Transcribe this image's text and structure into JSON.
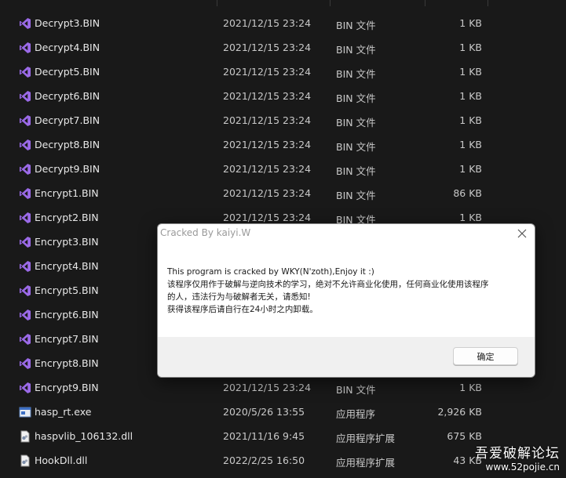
{
  "files": [
    {
      "name": "Decrypt3.BIN",
      "date": "2021/12/15 23:24",
      "type": "BIN 文件",
      "size": "1 KB",
      "icon": "vs-icon"
    },
    {
      "name": "Decrypt4.BIN",
      "date": "2021/12/15 23:24",
      "type": "BIN 文件",
      "size": "1 KB",
      "icon": "vs-icon"
    },
    {
      "name": "Decrypt5.BIN",
      "date": "2021/12/15 23:24",
      "type": "BIN 文件",
      "size": "1 KB",
      "icon": "vs-icon"
    },
    {
      "name": "Decrypt6.BIN",
      "date": "2021/12/15 23:24",
      "type": "BIN 文件",
      "size": "1 KB",
      "icon": "vs-icon"
    },
    {
      "name": "Decrypt7.BIN",
      "date": "2021/12/15 23:24",
      "type": "BIN 文件",
      "size": "1 KB",
      "icon": "vs-icon"
    },
    {
      "name": "Decrypt8.BIN",
      "date": "2021/12/15 23:24",
      "type": "BIN 文件",
      "size": "1 KB",
      "icon": "vs-icon"
    },
    {
      "name": "Decrypt9.BIN",
      "date": "2021/12/15 23:24",
      "type": "BIN 文件",
      "size": "1 KB",
      "icon": "vs-icon"
    },
    {
      "name": "Encrypt1.BIN",
      "date": "2021/12/15 23:24",
      "type": "BIN 文件",
      "size": "86 KB",
      "icon": "vs-icon"
    },
    {
      "name": "Encrypt2.BIN",
      "date": "2021/12/15 23:24",
      "type": "BIN 文件",
      "size": "1 KB",
      "icon": "vs-icon"
    },
    {
      "name": "Encrypt3.BIN",
      "date": "",
      "type": "",
      "size": "",
      "icon": "vs-icon"
    },
    {
      "name": "Encrypt4.BIN",
      "date": "",
      "type": "",
      "size": "",
      "icon": "vs-icon"
    },
    {
      "name": "Encrypt5.BIN",
      "date": "",
      "type": "",
      "size": "",
      "icon": "vs-icon"
    },
    {
      "name": "Encrypt6.BIN",
      "date": "",
      "type": "",
      "size": "",
      "icon": "vs-icon"
    },
    {
      "name": "Encrypt7.BIN",
      "date": "",
      "type": "",
      "size": "",
      "icon": "vs-icon"
    },
    {
      "name": "Encrypt8.BIN",
      "date": "",
      "type": "",
      "size": "",
      "icon": "vs-icon"
    },
    {
      "name": "Encrypt9.BIN",
      "date": "2021/12/15 23:24",
      "type": "BIN 文件",
      "size": "1 KB",
      "icon": "vs-icon"
    },
    {
      "name": "hasp_rt.exe",
      "date": "2020/5/26 13:55",
      "type": "应用程序",
      "size": "2,926 KB",
      "icon": "exe-icon"
    },
    {
      "name": "haspvlib_106132.dll",
      "date": "2021/11/16 9:45",
      "type": "应用程序扩展",
      "size": "675 KB",
      "icon": "dll-icon"
    },
    {
      "name": "HookDll.dll",
      "date": "2022/2/25 16:50",
      "type": "应用程序扩展",
      "size": "43 KB",
      "icon": "dll-icon"
    }
  ],
  "dialog": {
    "title": "Cracked By kaiyi.W",
    "lines": [
      "This program is cracked by WKY(N'zoth),Enjoy it :)",
      "该程序仅用作于破解与逆向技术的学习，绝对不允许商业化使用，任何商业化使用该程序",
      "的人，违法行为与破解者无关，请悉知!",
      "获得该程序后请自行在24小时之内卸载。"
    ],
    "ok_label": "确定"
  },
  "watermark": {
    "title": "吾爱破解论坛",
    "url": "www.52pojie.cn"
  },
  "colors": {
    "background": "#191919",
    "vs_purple": "#8b5cd8",
    "dialog_bg": "#ffffff",
    "dialog_footer": "#f0f0f0"
  }
}
